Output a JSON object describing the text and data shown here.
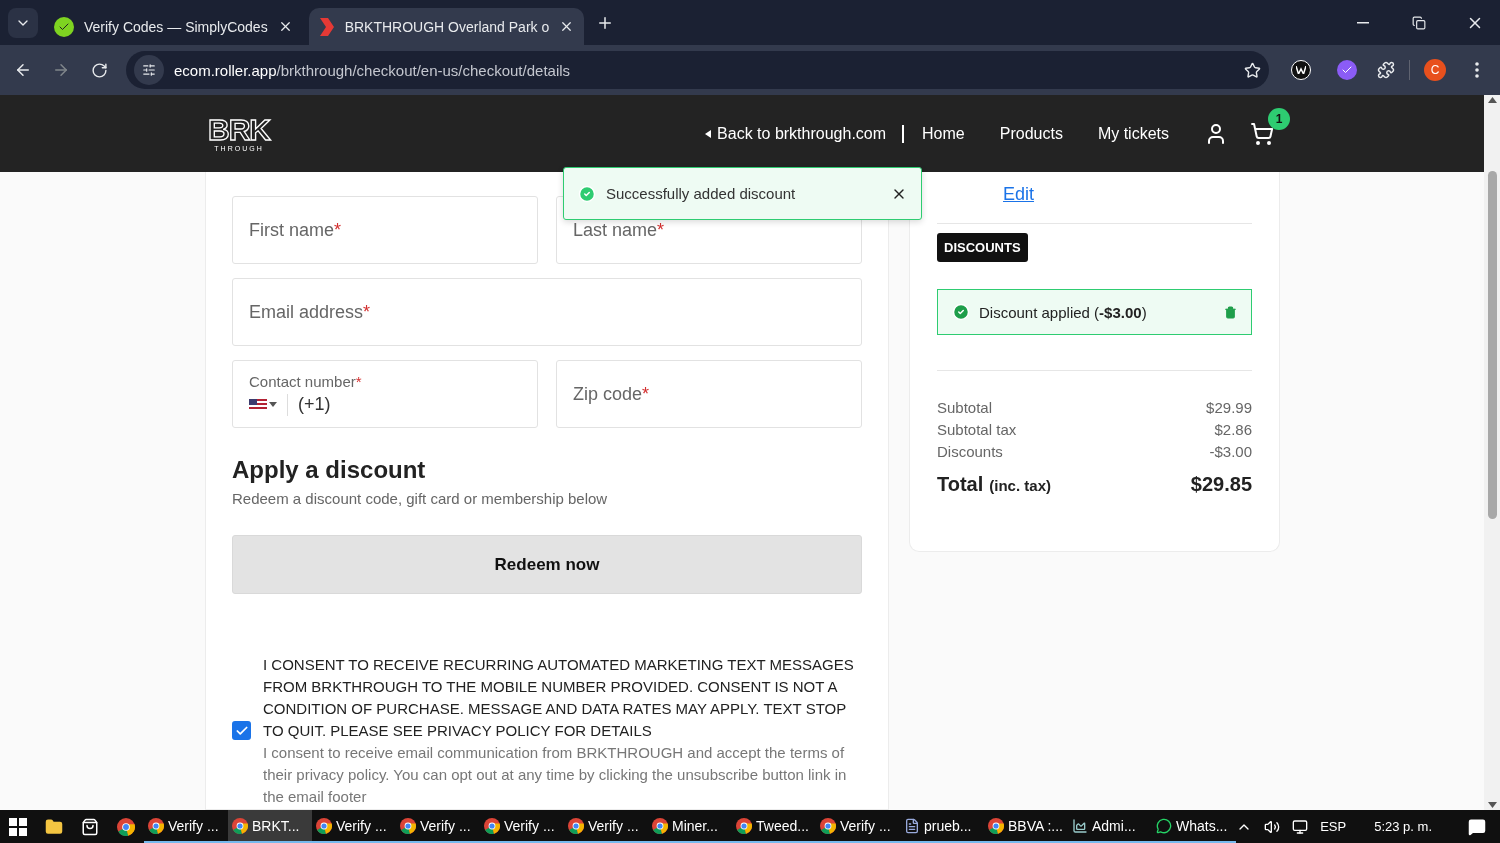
{
  "browser": {
    "tabs": [
      {
        "title": "Verify Codes — SimplyCodes",
        "selected": false,
        "kind": "simplycodes"
      },
      {
        "title": "BRKTHROUGH Overland Park o",
        "selected": true,
        "kind": "brk"
      }
    ],
    "url_host": "ecom.roller.app",
    "url_path": "/brkthrough/checkout/en-us/checkout/details",
    "profile_initial": "C"
  },
  "site": {
    "logo": "BRK",
    "logo_sub": "THROUGH",
    "back_link": "Back to brkthrough.com",
    "nav": [
      "Home",
      "Products",
      "My tickets"
    ],
    "cart_count": "1"
  },
  "toast": {
    "text": "Successfully added discount"
  },
  "form": {
    "required_mark": "*",
    "fields": [
      {
        "label": "First name",
        "kind": "text"
      },
      {
        "label": "Last name",
        "kind": "text"
      },
      {
        "label": "Email address",
        "kind": "wide"
      },
      {
        "label": "Contact number",
        "kind": "phone",
        "value": "(+1)"
      },
      {
        "label": "Zip code",
        "kind": "text"
      }
    ],
    "discount_title": "Apply a discount",
    "discount_subtitle": "Redeem a discount code, gift card or membership below",
    "redeem_button": "Redeem now",
    "consent": {
      "checked": true,
      "text": "I CONSENT TO RECEIVE RECURRING AUTOMATED MARKETING TEXT MESSAGES FROM BRKTHROUGH TO THE MOBILE NUMBER PROVIDED. CONSENT IS NOT A CONDITION OF PURCHASE. MESSAGE AND DATA RATES MAY APPLY. TEXT STOP TO QUIT. PLEASE SEE PRIVACY POLICY FOR DETAILS",
      "email_text": "I consent to receive email communication from BRKTHROUGH and accept the terms of their privacy policy. You can opt out at any time by clicking the unsubscribe button link in the email footer"
    }
  },
  "summary": {
    "edit_link": "Edit",
    "discounts_tag": "DISCOUNTS",
    "applied": "Discount applied (**-$3.00**)",
    "rows": [
      {
        "label": "Subtotal",
        "value": "$29.99"
      },
      {
        "label": "Subtotal tax",
        "value": "$2.86"
      },
      {
        "label": "Discounts",
        "value": "-$3.00"
      }
    ],
    "total_label": "Total",
    "total_note": "(inc. tax)",
    "total_value": "$29.85"
  },
  "taskbar": {
    "apps": [
      {
        "label": "Verify ...",
        "selected": false
      },
      {
        "label": "BRKT...",
        "selected": true
      },
      {
        "label": "Verify ...",
        "selected": false
      },
      {
        "label": "Verify ...",
        "selected": false
      },
      {
        "label": "Verify ...",
        "selected": false
      },
      {
        "label": "Verify ...",
        "selected": false
      },
      {
        "label": "Miner...",
        "selected": false
      },
      {
        "label": "Tweed...",
        "selected": false
      },
      {
        "label": "Verify ...",
        "selected": false
      },
      {
        "label": "prueb...",
        "selected": false
      },
      {
        "label": "BBVA :...",
        "selected": false
      },
      {
        "label": "Admi...",
        "selected": false
      },
      {
        "label": "Whats...",
        "selected": false
      }
    ],
    "language": "ESP",
    "time": "5:23 p. m."
  }
}
